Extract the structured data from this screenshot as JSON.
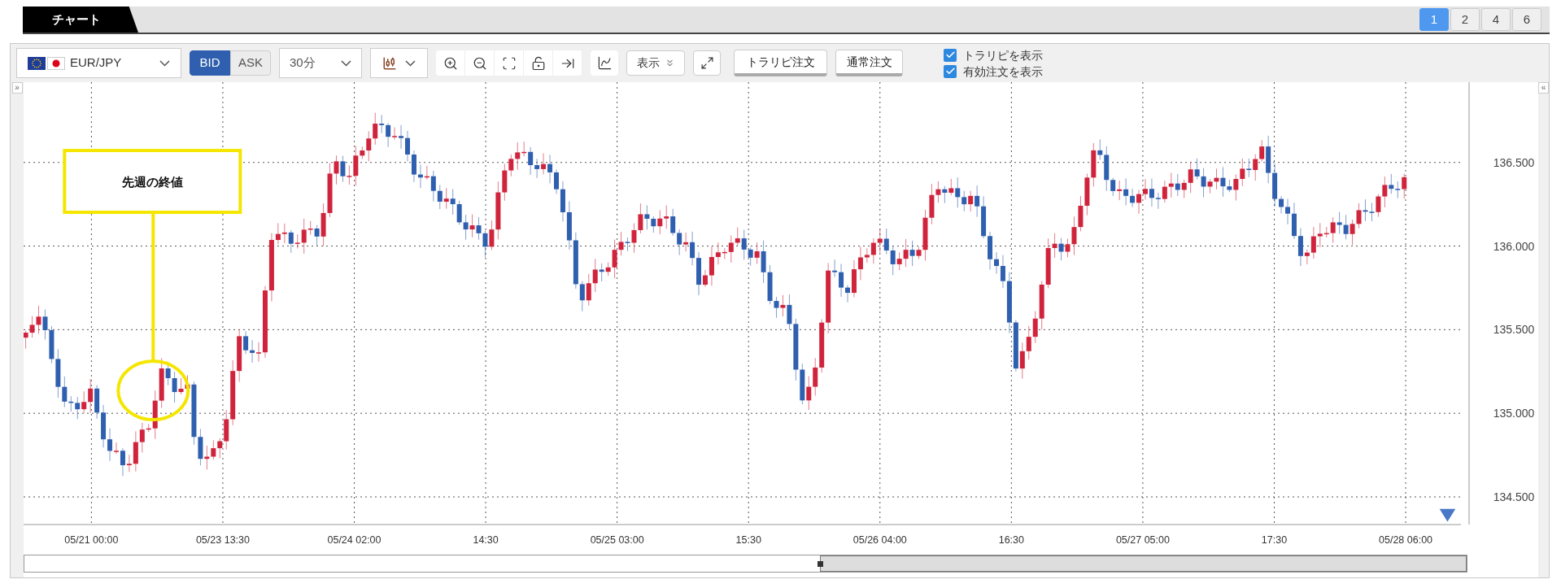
{
  "tabs": [
    {
      "label": "チャート",
      "selected": true
    }
  ],
  "layout_buttons": [
    {
      "label": "1",
      "selected": true
    },
    {
      "label": "2",
      "selected": false
    },
    {
      "label": "4",
      "selected": false
    },
    {
      "label": "6",
      "selected": false
    }
  ],
  "toolbar": {
    "symbol": {
      "value": "EUR/JPY"
    },
    "price_side": [
      {
        "label": "BID",
        "selected": true
      },
      {
        "label": "ASK",
        "selected": false
      }
    ],
    "timeframe": {
      "value": "30分"
    },
    "display_menu": {
      "label": "表示"
    },
    "buttons": [
      "トラリピ注文",
      "通常注文"
    ],
    "checkboxes": [
      {
        "label": "トラリピを表示",
        "checked": true
      },
      {
        "label": "有効注文を表示",
        "checked": true
      }
    ]
  },
  "chart": {
    "expand_left": "»",
    "collapse_right": "«",
    "y_labels": [
      "136.500",
      "136.000",
      "135.500",
      "135.000",
      "134.500"
    ],
    "x_labels": [
      "05/21 00:00",
      "05/23 13:30",
      "05/24 02:00",
      "14:30",
      "05/25 03:00",
      "15:30",
      "05/26 04:00",
      "16:30",
      "05/27 05:00",
      "17:30",
      "05/28 06:00"
    ],
    "callout": "先週の終値"
  }
}
